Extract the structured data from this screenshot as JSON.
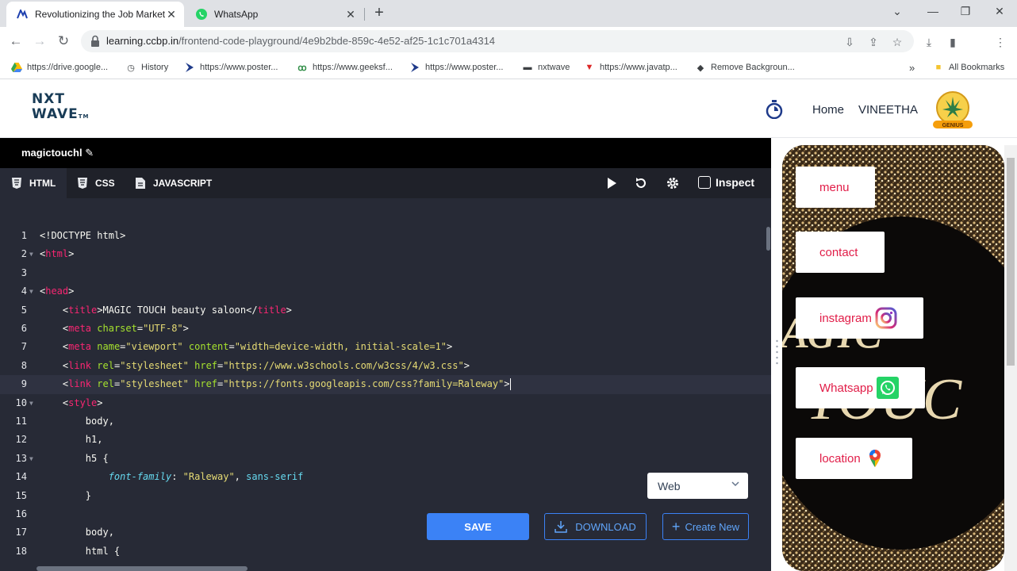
{
  "browser": {
    "tabs": [
      {
        "title": "Revolutionizing the Job Market",
        "active": true
      },
      {
        "title": "WhatsApp",
        "active": false
      }
    ],
    "url_host": "learning.ccbp.in",
    "url_path": "/frontend-code-playground/4e9b2bde-859c-4e52-af25-1c1c701a4314",
    "bookmarks": [
      "https://drive.google...",
      "History",
      "https://www.poster...",
      "https://www.geeksf...",
      "https://www.poster...",
      "nxtwave",
      "https://www.javatp...",
      "Remove Backgroun..."
    ],
    "all_bookmarks": "All Bookmarks",
    "overflow": "»"
  },
  "site": {
    "logo_line1": "NXT",
    "logo_line2": "WAVE",
    "logo_tm": "TM",
    "nav_home": "Home",
    "nav_user": "VINEETHA",
    "badge": "GENIUS"
  },
  "editor": {
    "project_name": "magictouchl",
    "tabs": [
      "HTML",
      "CSS",
      "JAVASCRIPT"
    ],
    "inspect": "Inspect",
    "view_select": "Web",
    "save": "SAVE",
    "download": "DOWNLOAD",
    "create_new": "Create New",
    "line_numbers": [
      "1",
      "2",
      "3",
      "4",
      "5",
      "6",
      "7",
      "8",
      "9",
      "10",
      "11",
      "12",
      "13",
      "14",
      "15",
      "16",
      "17",
      "18"
    ]
  },
  "preview": {
    "buttons": [
      "menu",
      "contact",
      "instagram",
      "Whatsapp",
      "location"
    ]
  },
  "colors": {
    "accent": "#3b82f6",
    "preview_link": "#e11d48",
    "editor_bg": "#272a36"
  }
}
